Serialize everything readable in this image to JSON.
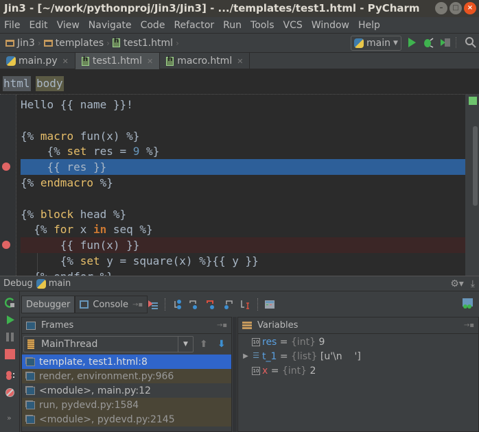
{
  "window": {
    "title": "Jin3 - [~/work/pythonproj/Jin3/Jin3] - .../templates/test1.html - PyCharm",
    "buttons": [
      "minimize",
      "maximize",
      "close"
    ]
  },
  "menu": [
    {
      "label": "File",
      "mnemonic": "F",
      "rest": "ile"
    },
    {
      "label": "Edit",
      "mnemonic": "E",
      "rest": "dit"
    },
    {
      "label": "View",
      "mnemonic": "V",
      "rest": "iew"
    },
    {
      "label": "Navigate",
      "mnemonic": "N",
      "rest": "avigate"
    },
    {
      "label": "Code",
      "mnemonic": "C",
      "rest": "ode"
    },
    {
      "label": "Refactor",
      "mnemonic": "R",
      "rest": "efactor"
    },
    {
      "label": "Run",
      "pre": "R",
      "mnemonic": "u",
      "rest": "n"
    },
    {
      "label": "Tools",
      "mnemonic": "T",
      "rest": "ools"
    },
    {
      "label": "VCS",
      "pre": "VC",
      "mnemonic": "S",
      "rest": ""
    },
    {
      "label": "Window",
      "mnemonic": "W",
      "rest": "indow"
    },
    {
      "label": "Help",
      "mnemonic": "H",
      "rest": "elp"
    }
  ],
  "navbar": {
    "crumbs": [
      "Jin3",
      "templates",
      "test1.html"
    ],
    "run_config": "main",
    "icons": [
      "run-icon",
      "debug-icon",
      "coverage-icon",
      "search-icon"
    ]
  },
  "tabs": [
    {
      "label": "main.py",
      "icon": "python-file-icon",
      "active": false
    },
    {
      "label": "test1.html",
      "icon": "html-file-icon",
      "active": true
    },
    {
      "label": "macro.html",
      "icon": "html-file-icon",
      "active": false
    }
  ],
  "tagbar": {
    "tags": [
      "html",
      "body"
    ]
  },
  "editor": {
    "lines": [
      {
        "segments": [
          {
            "t": "Hello {{ name }}!",
            "c": ""
          }
        ],
        "state": ""
      },
      {
        "segments": [],
        "state": ""
      },
      {
        "segments": [
          {
            "t": "{% ",
            "c": ""
          },
          {
            "t": "macro",
            "c": "kw"
          },
          {
            "t": " fun(x) %}",
            "c": ""
          }
        ],
        "state": ""
      },
      {
        "segments": [
          {
            "t": "    {% ",
            "c": ""
          },
          {
            "t": "set",
            "c": "kw"
          },
          {
            "t": " res = ",
            "c": ""
          },
          {
            "t": "9",
            "c": "num"
          },
          {
            "t": " %}",
            "c": ""
          }
        ],
        "state": ""
      },
      {
        "segments": [
          {
            "t": "    {{ res }}",
            "c": ""
          }
        ],
        "state": "exec",
        "breakpoint": true
      },
      {
        "segments": [
          {
            "t": "{% ",
            "c": ""
          },
          {
            "t": "endmacro",
            "c": "kw"
          },
          {
            "t": " %}",
            "c": ""
          }
        ],
        "state": ""
      },
      {
        "segments": [],
        "state": ""
      },
      {
        "segments": [
          {
            "t": "{% ",
            "c": ""
          },
          {
            "t": "block",
            "c": "kw"
          },
          {
            "t": " head %}",
            "c": ""
          }
        ],
        "state": ""
      },
      {
        "segments": [
          {
            "t": "  {% ",
            "c": ""
          },
          {
            "t": "for",
            "c": "kw"
          },
          {
            "t": " x ",
            "c": ""
          },
          {
            "t": "in",
            "c": "kwb"
          },
          {
            "t": " seq %}",
            "c": ""
          }
        ],
        "state": ""
      },
      {
        "segments": [
          {
            "t": "      {{ fun(x) }}",
            "c": ""
          }
        ],
        "state": "bp",
        "breakpoint": true
      },
      {
        "segments": [
          {
            "t": "      {% ",
            "c": ""
          },
          {
            "t": "set",
            "c": "kw"
          },
          {
            "t": " y = square(x) %}{{ y }}",
            "c": ""
          }
        ],
        "state": ""
      },
      {
        "segments": [
          {
            "t": "  {% endfor %}",
            "c": ""
          }
        ],
        "state": ""
      }
    ]
  },
  "debug": {
    "title": "Debug",
    "config": "main",
    "tabs": [
      {
        "label": "Debugger",
        "active": true
      },
      {
        "label": "Console",
        "active": false
      }
    ],
    "toolbar_icons": [
      "show-execution-point-icon",
      "step-over-icon",
      "step-into-icon",
      "step-into-my-code-icon",
      "step-out-icon",
      "run-to-cursor-icon",
      "evaluate-expression-icon"
    ],
    "side_icons": [
      "rerun-icon",
      "resume-icon",
      "pause-icon",
      "stop-icon",
      "view-breakpoints-icon",
      "mute-breakpoints-icon",
      "more-icon"
    ],
    "frames": {
      "title": "Frames",
      "thread": "MainThread",
      "items": [
        {
          "label": "template, test1.html:8",
          "kind": "sel"
        },
        {
          "label": "render, environment.py:966",
          "kind": "lib"
        },
        {
          "label": "<module>, main.py:12",
          "kind": "usr"
        },
        {
          "label": "run, pydevd.py:1584",
          "kind": "lib"
        },
        {
          "label": "<module>, pydevd.py:2145",
          "kind": "lib"
        }
      ]
    },
    "variables": {
      "title": "Variables",
      "items": [
        {
          "name": "res",
          "type": "{int}",
          "value": "9",
          "expandable": false,
          "changed": false,
          "icon": "int"
        },
        {
          "name": "t_1",
          "type": "{list}",
          "value": "[u'\\n    ']",
          "expandable": true,
          "changed": false,
          "icon": "list"
        },
        {
          "name": "x",
          "type": "{int}",
          "value": "2",
          "expandable": false,
          "changed": true,
          "icon": "int"
        }
      ]
    }
  }
}
